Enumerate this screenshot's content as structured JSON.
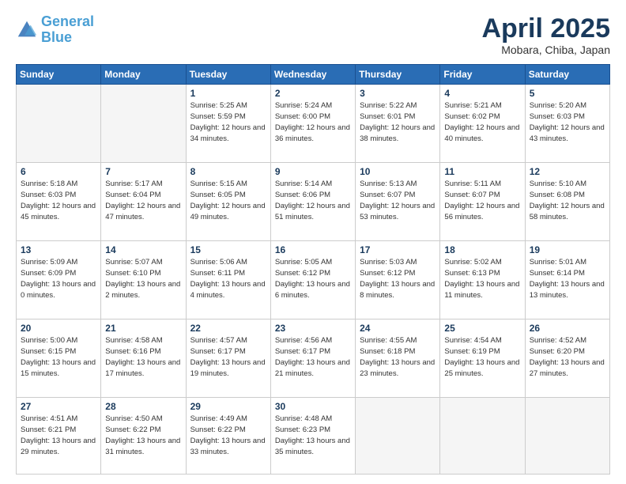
{
  "logo": {
    "line1": "General",
    "line2": "Blue"
  },
  "title": "April 2025",
  "location": "Mobara, Chiba, Japan",
  "days_header": [
    "Sunday",
    "Monday",
    "Tuesday",
    "Wednesday",
    "Thursday",
    "Friday",
    "Saturday"
  ],
  "weeks": [
    [
      {
        "num": "",
        "info": ""
      },
      {
        "num": "",
        "info": ""
      },
      {
        "num": "1",
        "info": "Sunrise: 5:25 AM\nSunset: 5:59 PM\nDaylight: 12 hours and 34 minutes."
      },
      {
        "num": "2",
        "info": "Sunrise: 5:24 AM\nSunset: 6:00 PM\nDaylight: 12 hours and 36 minutes."
      },
      {
        "num": "3",
        "info": "Sunrise: 5:22 AM\nSunset: 6:01 PM\nDaylight: 12 hours and 38 minutes."
      },
      {
        "num": "4",
        "info": "Sunrise: 5:21 AM\nSunset: 6:02 PM\nDaylight: 12 hours and 40 minutes."
      },
      {
        "num": "5",
        "info": "Sunrise: 5:20 AM\nSunset: 6:03 PM\nDaylight: 12 hours and 43 minutes."
      }
    ],
    [
      {
        "num": "6",
        "info": "Sunrise: 5:18 AM\nSunset: 6:03 PM\nDaylight: 12 hours and 45 minutes."
      },
      {
        "num": "7",
        "info": "Sunrise: 5:17 AM\nSunset: 6:04 PM\nDaylight: 12 hours and 47 minutes."
      },
      {
        "num": "8",
        "info": "Sunrise: 5:15 AM\nSunset: 6:05 PM\nDaylight: 12 hours and 49 minutes."
      },
      {
        "num": "9",
        "info": "Sunrise: 5:14 AM\nSunset: 6:06 PM\nDaylight: 12 hours and 51 minutes."
      },
      {
        "num": "10",
        "info": "Sunrise: 5:13 AM\nSunset: 6:07 PM\nDaylight: 12 hours and 53 minutes."
      },
      {
        "num": "11",
        "info": "Sunrise: 5:11 AM\nSunset: 6:07 PM\nDaylight: 12 hours and 56 minutes."
      },
      {
        "num": "12",
        "info": "Sunrise: 5:10 AM\nSunset: 6:08 PM\nDaylight: 12 hours and 58 minutes."
      }
    ],
    [
      {
        "num": "13",
        "info": "Sunrise: 5:09 AM\nSunset: 6:09 PM\nDaylight: 13 hours and 0 minutes."
      },
      {
        "num": "14",
        "info": "Sunrise: 5:07 AM\nSunset: 6:10 PM\nDaylight: 13 hours and 2 minutes."
      },
      {
        "num": "15",
        "info": "Sunrise: 5:06 AM\nSunset: 6:11 PM\nDaylight: 13 hours and 4 minutes."
      },
      {
        "num": "16",
        "info": "Sunrise: 5:05 AM\nSunset: 6:12 PM\nDaylight: 13 hours and 6 minutes."
      },
      {
        "num": "17",
        "info": "Sunrise: 5:03 AM\nSunset: 6:12 PM\nDaylight: 13 hours and 8 minutes."
      },
      {
        "num": "18",
        "info": "Sunrise: 5:02 AM\nSunset: 6:13 PM\nDaylight: 13 hours and 11 minutes."
      },
      {
        "num": "19",
        "info": "Sunrise: 5:01 AM\nSunset: 6:14 PM\nDaylight: 13 hours and 13 minutes."
      }
    ],
    [
      {
        "num": "20",
        "info": "Sunrise: 5:00 AM\nSunset: 6:15 PM\nDaylight: 13 hours and 15 minutes."
      },
      {
        "num": "21",
        "info": "Sunrise: 4:58 AM\nSunset: 6:16 PM\nDaylight: 13 hours and 17 minutes."
      },
      {
        "num": "22",
        "info": "Sunrise: 4:57 AM\nSunset: 6:17 PM\nDaylight: 13 hours and 19 minutes."
      },
      {
        "num": "23",
        "info": "Sunrise: 4:56 AM\nSunset: 6:17 PM\nDaylight: 13 hours and 21 minutes."
      },
      {
        "num": "24",
        "info": "Sunrise: 4:55 AM\nSunset: 6:18 PM\nDaylight: 13 hours and 23 minutes."
      },
      {
        "num": "25",
        "info": "Sunrise: 4:54 AM\nSunset: 6:19 PM\nDaylight: 13 hours and 25 minutes."
      },
      {
        "num": "26",
        "info": "Sunrise: 4:52 AM\nSunset: 6:20 PM\nDaylight: 13 hours and 27 minutes."
      }
    ],
    [
      {
        "num": "27",
        "info": "Sunrise: 4:51 AM\nSunset: 6:21 PM\nDaylight: 13 hours and 29 minutes."
      },
      {
        "num": "28",
        "info": "Sunrise: 4:50 AM\nSunset: 6:22 PM\nDaylight: 13 hours and 31 minutes."
      },
      {
        "num": "29",
        "info": "Sunrise: 4:49 AM\nSunset: 6:22 PM\nDaylight: 13 hours and 33 minutes."
      },
      {
        "num": "30",
        "info": "Sunrise: 4:48 AM\nSunset: 6:23 PM\nDaylight: 13 hours and 35 minutes."
      },
      {
        "num": "",
        "info": ""
      },
      {
        "num": "",
        "info": ""
      },
      {
        "num": "",
        "info": ""
      }
    ]
  ]
}
